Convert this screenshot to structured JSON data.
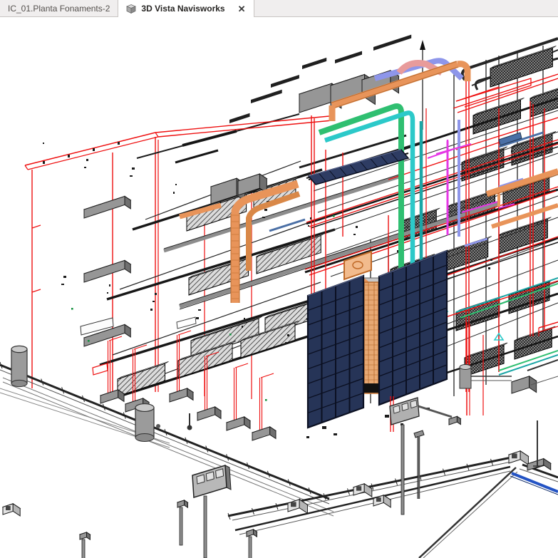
{
  "tabs": [
    {
      "label": "IC_01.Planta Fonaments-2",
      "active": false
    },
    {
      "label": "3D Vista Navisworks",
      "active": true,
      "icon": "navisworks-3d-box-icon",
      "close_glyph": "✕"
    }
  ],
  "viewport": {
    "content": "3D isometric BIM model view"
  },
  "colors": {
    "tabbar_bg": "#f0eeee",
    "tab_active_bg": "#ffffff",
    "tab_border": "#c9c5c2",
    "tab_text_inactive": "#54504d",
    "tab_text_active": "#262422",
    "canvas_bg": "#ffffff",
    "line_black": "#1a1a1a",
    "pipe_red": "#ee1010",
    "duct_orange": "#e8945a",
    "duct_orange_dark": "#b96a2e",
    "duct_green": "#2fbf71",
    "duct_cyan": "#2cc9c9",
    "duct_teal": "#1ba6a6",
    "duct_periwinkle": "#8e96ea",
    "duct_magenta": "#e437e4",
    "duct_pink": "#e89b9b",
    "panel_navy": "#263457",
    "panel_navy_dark": "#0b1022",
    "solar_navy": "#2e3c63",
    "pipe_blue": "#2353c4",
    "steel_blue": "#4a6fa5",
    "gray_light": "#c6c6c6",
    "gray_mid": "#969696",
    "gray_dark": "#6f6f6f"
  }
}
